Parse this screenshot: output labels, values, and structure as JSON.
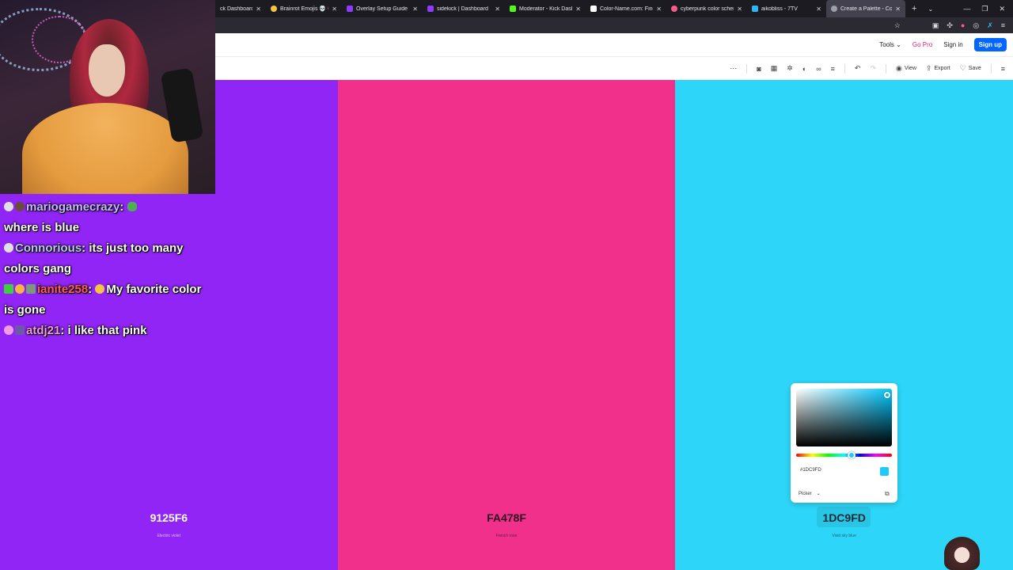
{
  "tabs": [
    {
      "label": "ck Dashboard",
      "color": "#53fc18"
    },
    {
      "label": "Brainrot Emojis 💀 🤡 👌 |",
      "color": "#f5c542"
    },
    {
      "label": "Overlay Setup Guide",
      "color": "#8b3dff"
    },
    {
      "label": "sidekick | Dashboard",
      "color": "#8b3dff"
    },
    {
      "label": "Moderator - Kick Dashboard",
      "color": "#53fc18"
    },
    {
      "label": "Color-Name.com: Find nam",
      "color": "#ffffff"
    },
    {
      "label": "cyberpunk color scheme at",
      "color": "#ff5b8a"
    },
    {
      "label": "aikobliss - 7TV",
      "color": "#29b6f6"
    },
    {
      "label": "Create a Palette - Coolors",
      "color": "#0066ff",
      "active": true
    }
  ],
  "header": {
    "tools": "Tools",
    "gopro": "Go Pro",
    "signin": "Sign in",
    "signup": "Sign up"
  },
  "toolbar": {
    "view": "View",
    "export": "Export",
    "save": "Save"
  },
  "palette": [
    {
      "hex": "9125F6",
      "name": "Electric violet",
      "color": "#9125F6",
      "text": "#ffffff"
    },
    {
      "hex": "FA478F",
      "name": "French rose",
      "color": "#F0308B",
      "text": "#2a1020"
    },
    {
      "hex": "1DC9FD",
      "name": "Vivid sky blue",
      "color": "#2DD6F8",
      "text": "#0d2a33"
    }
  ],
  "chat": [
    {
      "user": "mariogamecrazy",
      "message": "where is blue"
    },
    {
      "user": "Connorious",
      "message": "its just too many colors gang"
    },
    {
      "user": "ianite258",
      "message": "My favorite color is gone"
    },
    {
      "user": "atdj21",
      "message": "i like that pink"
    }
  ],
  "picker": {
    "hex_value": "#1DC9FD",
    "mode": "Picker"
  }
}
